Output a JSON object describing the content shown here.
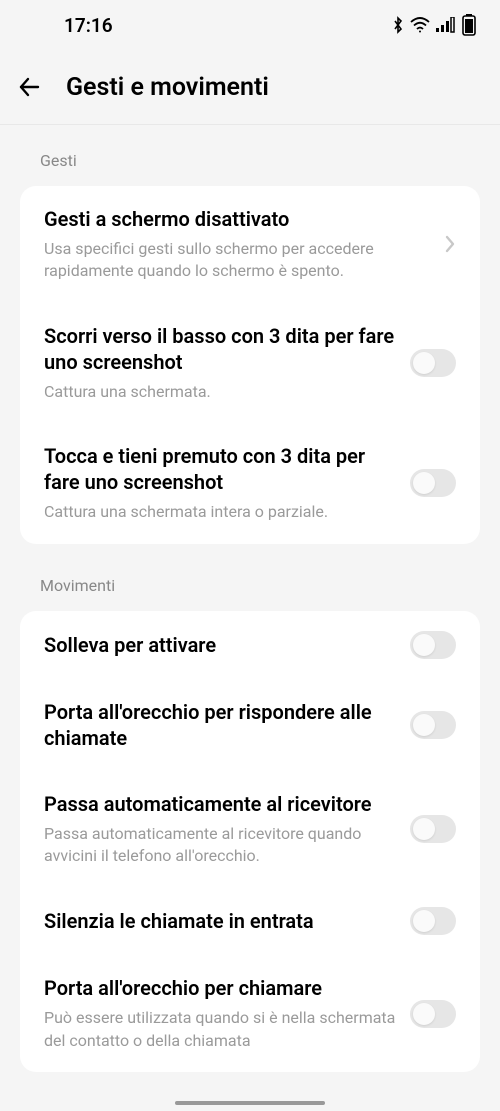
{
  "status": {
    "time": "17:16"
  },
  "header": {
    "title": "Gesti e movimenti"
  },
  "section1": {
    "label": "Gesti",
    "items": [
      {
        "title": "Gesti a schermo disattivato",
        "subtitle": "Usa specifici gesti sullo schermo per accedere rapidamente quando lo schermo è spento."
      },
      {
        "title": "Scorri verso il basso con 3 dita per fare uno screenshot",
        "subtitle": "Cattura una schermata."
      },
      {
        "title": "Tocca e tieni premuto con 3 dita per fare uno screenshot",
        "subtitle": "Cattura una schermata intera o parziale."
      }
    ]
  },
  "section2": {
    "label": "Movimenti",
    "items": [
      {
        "title": "Solleva per attivare"
      },
      {
        "title": "Porta all'orecchio per rispondere alle chiamate"
      },
      {
        "title": "Passa automaticamente al ricevitore",
        "subtitle": "Passa automaticamente al ricevitore quando avvicini il telefono all'orecchio."
      },
      {
        "title": "Silenzia le chiamate in entrata"
      },
      {
        "title": "Porta all'orecchio per chiamare",
        "subtitle": "Può essere utilizzata quando si è nella schermata del contatto o della chiamata"
      }
    ]
  }
}
